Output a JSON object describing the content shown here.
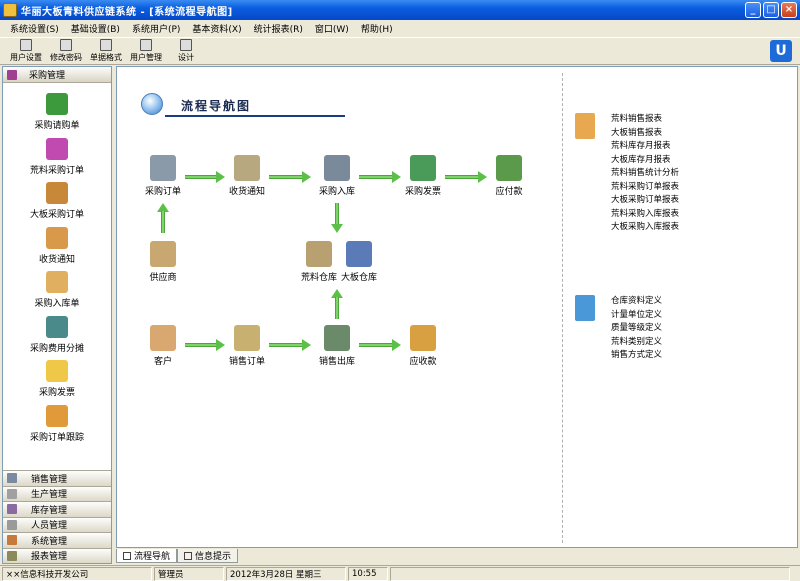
{
  "window": {
    "title": "华丽大板青料供应链系统 - [系统流程导航图]"
  },
  "menu": [
    "系统设置(S)",
    "基础设置(B)",
    "系统用户(P)",
    "基本资料(X)",
    "统计报表(R)",
    "窗口(W)",
    "帮助(H)"
  ],
  "toolbar": [
    "用户设置",
    "修改密码",
    "单据格式",
    "用户管理",
    "设计"
  ],
  "brand_logo": "U",
  "sidebar": {
    "header": "采购管理",
    "items": [
      "采购请购单",
      "荒料采购订单",
      "大板采购订单",
      "收货通知",
      "采购入库单",
      "采购费用分摊",
      "采购发票",
      "采购订单跟踪"
    ],
    "groups": [
      "销售管理",
      "生产管理",
      "库存管理",
      "人员管理",
      "系统管理",
      "报表管理"
    ]
  },
  "flow": {
    "title": "流程导航图",
    "nodes": {
      "purchase_order": "采购订单",
      "receipt_notice": "收货通知",
      "purchase_in": "采购入库",
      "purchase_invoice": "采购发票",
      "payable": "应付款",
      "supplier": "供应商",
      "rough_stock": "荒料仓库",
      "slab_stock": "大板仓库",
      "customer": "客户",
      "sales_order": "销售订单",
      "sales_out": "销售出库",
      "receivable": "应收款"
    }
  },
  "reports_1": [
    "荒料销售报表",
    "大板销售报表",
    "荒料库存月报表",
    "大板库存月报表",
    "荒料销售统计分析",
    "荒料采购订单报表",
    "大板采购订单报表",
    "荒料采购入库报表",
    "大板采购入库报表"
  ],
  "reports_2": [
    "仓库资料定义",
    "计量单位定义",
    "质量等级定义",
    "荒料类别定义",
    "销售方式定义"
  ],
  "tabs": [
    "流程导航",
    "信息提示"
  ],
  "status": [
    "××信息科技开发公司",
    "管理员",
    "2012年3月28日 星期三",
    "10:55"
  ]
}
